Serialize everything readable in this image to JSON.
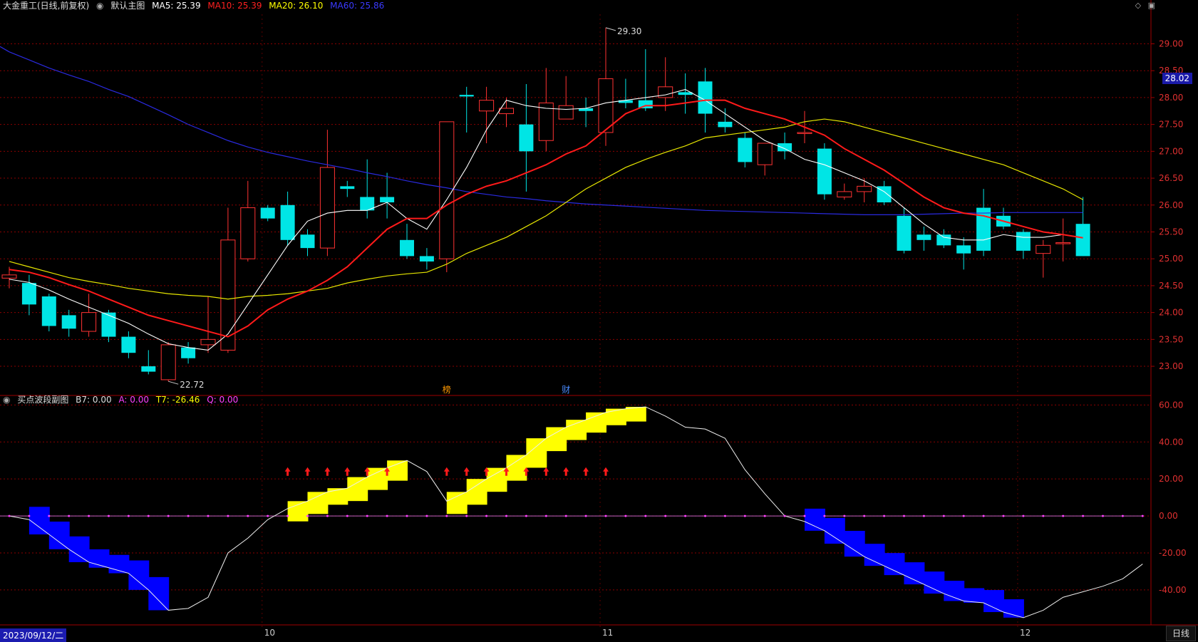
{
  "header": {
    "stock": "大金重工(日线,前复权)",
    "main_label": "默认主图",
    "ma": [
      {
        "label": "MA5: 25.39",
        "color": "#ffffff"
      },
      {
        "label": "MA10: 25.39",
        "color": "#ff2020"
      },
      {
        "label": "MA20: 26.10",
        "color": "#ffff00"
      },
      {
        "label": "MA60: 25.86",
        "color": "#2020ff"
      }
    ]
  },
  "sub_header": {
    "title": "买点波段副图",
    "b7": "B7: 0.00",
    "a": "A: 0.00",
    "t7": "T7: -26.46",
    "q": "Q: 0.00"
  },
  "current_price_tag": "28.02",
  "price_axis_labels": [
    "29.00",
    "28.50",
    "28.00",
    "27.50",
    "27.00",
    "26.50",
    "26.00",
    "25.50",
    "25.00",
    "24.50",
    "24.00",
    "23.50",
    "23.00"
  ],
  "osc_axis_labels": [
    "60.00",
    "40.00",
    "20.00",
    "0.00",
    "-20.00",
    "-40.00"
  ],
  "annotations": {
    "high": "29.30",
    "low": "22.72",
    "event1": "榜",
    "event2": "财"
  },
  "x_axis": {
    "months": [
      "10",
      "11",
      "12"
    ],
    "date_box": "2023/09/12/二",
    "period_button": "日线"
  },
  "colors": {
    "up": "#ff3232",
    "down": "#00e5e5",
    "ma5": "#ffffff",
    "ma10": "#ff1a1a",
    "ma20": "#e6e600",
    "ma60": "#2a2ae0",
    "grid": "#8b0000"
  },
  "chart_data": {
    "type": "candlestick",
    "candles": [
      [
        24.64,
        24.7,
        24.85,
        24.45
      ],
      [
        24.55,
        24.15,
        24.7,
        23.95
      ],
      [
        24.3,
        23.75,
        24.35,
        23.65
      ],
      [
        23.95,
        23.7,
        24.05,
        23.55
      ],
      [
        23.65,
        24.0,
        24.35,
        23.55
      ],
      [
        24.0,
        23.55,
        24.05,
        23.45
      ],
      [
        23.55,
        23.25,
        23.65,
        23.15
      ],
      [
        23.0,
        22.9,
        23.3,
        22.85
      ],
      [
        22.75,
        23.4,
        23.45,
        22.72
      ],
      [
        23.35,
        23.15,
        23.45,
        23.05
      ],
      [
        23.4,
        23.5,
        24.3,
        23.25
      ],
      [
        23.3,
        25.35,
        25.95,
        23.25
      ],
      [
        25.0,
        25.95,
        26.45,
        24.95
      ],
      [
        25.95,
        25.75,
        26.0,
        25.7
      ],
      [
        26.0,
        25.35,
        26.25,
        25.25
      ],
      [
        25.45,
        25.2,
        25.55,
        25.05
      ],
      [
        25.2,
        26.7,
        27.4,
        25.05
      ],
      [
        26.35,
        26.3,
        26.45,
        26.15
      ],
      [
        26.15,
        25.9,
        26.85,
        25.75
      ],
      [
        26.15,
        26.05,
        26.6,
        25.75
      ],
      [
        25.35,
        25.05,
        25.65,
        25.0
      ],
      [
        25.05,
        24.95,
        25.2,
        24.8
      ],
      [
        25.0,
        27.55,
        27.55,
        24.75
      ],
      [
        28.05,
        28.02,
        28.2,
        27.35
      ],
      [
        27.75,
        27.95,
        28.2,
        27.15
      ],
      [
        27.7,
        27.8,
        28.0,
        27.45
      ],
      [
        27.5,
        27.0,
        28.25,
        26.25
      ],
      [
        27.2,
        27.9,
        28.55,
        27.0
      ],
      [
        27.6,
        27.85,
        28.4,
        27.6
      ],
      [
        27.8,
        27.75,
        28.0,
        27.45
      ],
      [
        27.35,
        28.35,
        29.3,
        27.1
      ],
      [
        27.95,
        27.9,
        28.35,
        27.8
      ],
      [
        27.95,
        27.8,
        28.9,
        27.75
      ],
      [
        28.0,
        28.2,
        28.75,
        27.75
      ],
      [
        28.1,
        28.05,
        28.45,
        27.7
      ],
      [
        28.3,
        27.7,
        28.55,
        27.35
      ],
      [
        27.55,
        27.45,
        27.8,
        27.35
      ],
      [
        27.25,
        26.8,
        27.35,
        26.7
      ],
      [
        26.75,
        27.15,
        27.15,
        26.55
      ],
      [
        27.15,
        27.0,
        27.35,
        26.85
      ],
      [
        27.35,
        27.35,
        27.75,
        27.15
      ],
      [
        27.05,
        26.2,
        27.15,
        26.1
      ],
      [
        26.15,
        26.25,
        26.4,
        26.1
      ],
      [
        26.25,
        26.35,
        26.5,
        26.05
      ],
      [
        26.35,
        26.05,
        26.45,
        26.0
      ],
      [
        25.8,
        25.15,
        25.95,
        25.1
      ],
      [
        25.45,
        25.35,
        25.6,
        25.15
      ],
      [
        25.45,
        25.25,
        25.55,
        25.2
      ],
      [
        25.25,
        25.1,
        25.4,
        24.8
      ],
      [
        25.95,
        25.15,
        26.3,
        25.05
      ],
      [
        25.8,
        25.6,
        25.95,
        25.55
      ],
      [
        25.5,
        25.15,
        25.55,
        25.0
      ],
      [
        25.1,
        25.25,
        25.35,
        24.65
      ],
      [
        25.3,
        25.3,
        25.75,
        24.95
      ],
      [
        25.65,
        25.05,
        26.15,
        25.05
      ]
    ],
    "ma5": [
      24.62,
      24.56,
      24.42,
      24.25,
      24.1,
      23.95,
      23.8,
      23.6,
      23.42,
      23.35,
      23.3,
      23.6,
      24.15,
      24.7,
      25.25,
      25.7,
      25.85,
      25.9,
      25.9,
      26.05,
      25.75,
      25.55,
      26.1,
      26.7,
      27.4,
      27.95,
      27.85,
      27.8,
      27.78,
      27.8,
      27.9,
      27.95,
      28.0,
      28.05,
      28.15,
      27.95,
      27.7,
      27.45,
      27.2,
      27.05,
      26.85,
      26.75,
      26.6,
      26.45,
      26.25,
      25.95,
      25.65,
      25.4,
      25.35,
      25.35,
      25.45,
      25.4,
      25.4,
      25.45,
      25.39
    ],
    "ma10": [
      24.8,
      24.75,
      24.65,
      24.52,
      24.4,
      24.25,
      24.1,
      23.95,
      23.85,
      23.75,
      23.65,
      23.55,
      23.75,
      24.05,
      24.25,
      24.4,
      24.6,
      24.85,
      25.2,
      25.55,
      25.75,
      25.75,
      26.0,
      26.2,
      26.35,
      26.45,
      26.6,
      26.75,
      26.95,
      27.1,
      27.4,
      27.7,
      27.85,
      27.85,
      27.9,
      27.95,
      27.95,
      27.8,
      27.7,
      27.6,
      27.45,
      27.3,
      27.05,
      26.85,
      26.65,
      26.4,
      26.15,
      25.95,
      25.85,
      25.8,
      25.7,
      25.6,
      25.5,
      25.45,
      25.39
    ],
    "ma20": [
      24.95,
      24.85,
      24.75,
      24.65,
      24.58,
      24.52,
      24.45,
      24.4,
      24.35,
      24.32,
      24.3,
      24.25,
      24.3,
      24.32,
      24.35,
      24.4,
      24.45,
      24.55,
      24.62,
      24.68,
      24.72,
      24.75,
      24.9,
      25.1,
      25.25,
      25.4,
      25.6,
      25.8,
      26.05,
      26.3,
      26.5,
      26.7,
      26.85,
      26.98,
      27.1,
      27.25,
      27.3,
      27.35,
      27.4,
      27.45,
      27.55,
      27.6,
      27.55,
      27.45,
      27.35,
      27.25,
      27.15,
      27.05,
      26.95,
      26.85,
      26.75,
      26.6,
      26.45,
      26.3,
      26.1
    ],
    "ma60": [
      28.85,
      28.7,
      28.55,
      28.42,
      28.3,
      28.15,
      28.02,
      27.85,
      27.68,
      27.5,
      27.35,
      27.2,
      27.08,
      26.98,
      26.9,
      26.82,
      26.75,
      26.68,
      26.6,
      26.53,
      26.45,
      26.38,
      26.32,
      26.25,
      26.2,
      26.15,
      26.12,
      26.08,
      26.05,
      26.02,
      26.0,
      25.98,
      25.96,
      25.94,
      25.92,
      25.9,
      25.89,
      25.88,
      25.87,
      25.86,
      25.85,
      25.84,
      25.83,
      25.82,
      25.82,
      25.82,
      25.83,
      25.84,
      25.85,
      25.85,
      25.86,
      25.86,
      25.86,
      25.86,
      25.86
    ],
    "osc": [
      0,
      -2,
      -10,
      -18,
      -25,
      -28,
      -31,
      -40,
      -51,
      -50,
      -44,
      -20,
      -12,
      -2,
      4,
      8,
      13,
      15,
      21,
      26,
      30,
      24,
      8,
      13,
      20,
      26,
      33,
      42,
      48,
      52,
      56,
      58,
      59,
      54,
      48,
      47,
      42,
      25,
      12,
      0,
      -3,
      -8,
      -15,
      -22,
      -27,
      -32,
      -37,
      -42,
      -46,
      -47,
      -52,
      -55,
      -51,
      -44,
      -41,
      -38,
      -34,
      -26
    ],
    "up_arrows": [
      14,
      15,
      16,
      17,
      18,
      19,
      22,
      23,
      24,
      25,
      26,
      27,
      28,
      29,
      30
    ],
    "y_price_range": [
      22.55,
      29.55
    ],
    "y_osc_range": [
      -57,
      64
    ]
  }
}
